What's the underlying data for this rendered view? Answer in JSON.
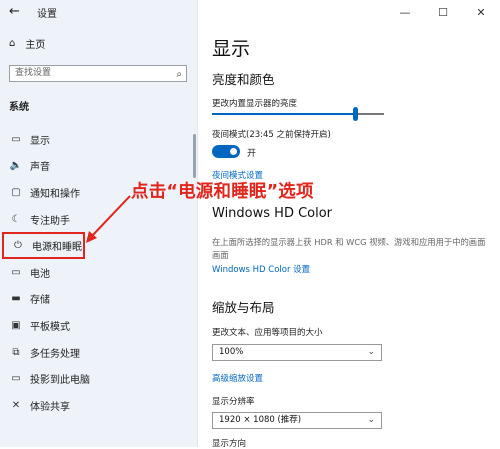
{
  "window": {
    "title": "设置",
    "back_icon": "←",
    "minimize": "—",
    "maximize": "☐",
    "close": "✕"
  },
  "sidebar": {
    "home": "主页",
    "search_placeholder": "查找设置",
    "section": "系统",
    "items": [
      {
        "label": "显示",
        "icon": "monitor-icon",
        "glyph": "▭"
      },
      {
        "label": "声音",
        "icon": "speaker-icon",
        "glyph": "🔈"
      },
      {
        "label": "通知和操作",
        "icon": "notification-icon",
        "glyph": "▢"
      },
      {
        "label": "专注助手",
        "icon": "moon-icon",
        "glyph": "☾"
      },
      {
        "label": "电源和睡眠",
        "icon": "power-icon",
        "glyph": "⏻"
      },
      {
        "label": "电池",
        "icon": "battery-icon",
        "glyph": "▭"
      },
      {
        "label": "存储",
        "icon": "storage-icon",
        "glyph": "▬"
      },
      {
        "label": "平板模式",
        "icon": "tablet-icon",
        "glyph": "▣"
      },
      {
        "label": "多任务处理",
        "icon": "multitask-icon",
        "glyph": "⧉"
      },
      {
        "label": "投影到此电脑",
        "icon": "project-icon",
        "glyph": "▭"
      },
      {
        "label": "体验共享",
        "icon": "share-icon",
        "glyph": "✕"
      }
    ]
  },
  "main": {
    "title": "显示",
    "brightness_heading": "亮度和颜色",
    "brightness_label": "更改内置显示器的亮度",
    "brightness_value": 0.83,
    "night_mode_label": "夜间模式(23:45 之前保持开启)",
    "night_toggle_label": "开",
    "night_settings_link": "夜间模式设置",
    "hdr_heading": "Windows HD Color",
    "hdr_desc": "在上面所选择的显示器上获 HDR 和 WCG 视频、游戏和应用用于中的画面画面",
    "hdr_link": "Windows HD Color 设置",
    "scale_heading": "缩放与布局",
    "scale_label": "更改文本、应用等项目的大小",
    "scale_value": "100%",
    "advanced_scale_link": "高级缩放设置",
    "resolution_label": "显示分辨率",
    "resolution_value": "1920 × 1080 (推荐)",
    "orientation_label": "显示方向"
  },
  "annotation": {
    "text": "点击“电源和睡眠”选项",
    "color": "#e0261d"
  }
}
